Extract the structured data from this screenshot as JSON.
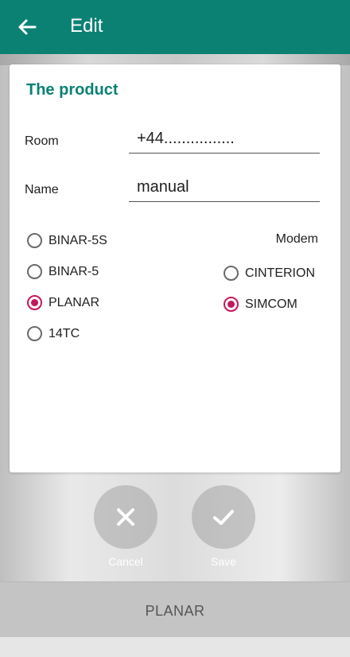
{
  "header": {
    "title": "Edit",
    "back_icon": "arrow-left-icon"
  },
  "card": {
    "title": "The product",
    "fields": [
      {
        "label": "Room",
        "value": "+44................"
      },
      {
        "label": "Name",
        "value": "manual"
      }
    ],
    "device_options": [
      {
        "label": "BINAR-5S",
        "selected": false
      },
      {
        "label": "BINAR-5",
        "selected": false
      },
      {
        "label": "PLANAR",
        "selected": true
      },
      {
        "label": "14TC",
        "selected": false
      }
    ],
    "modem": {
      "label": "Modem",
      "options": [
        {
          "label": "CINTERION",
          "selected": false
        },
        {
          "label": "SIMCOM",
          "selected": true
        }
      ]
    }
  },
  "actions": {
    "cancel": {
      "label": "Cancel",
      "icon": "close-icon"
    },
    "save": {
      "label": "Save",
      "icon": "check-icon"
    }
  },
  "bottom_bar": {
    "label": "PLANAR"
  },
  "colors": {
    "primary": "#0b8174",
    "accent": "#c2185b"
  }
}
